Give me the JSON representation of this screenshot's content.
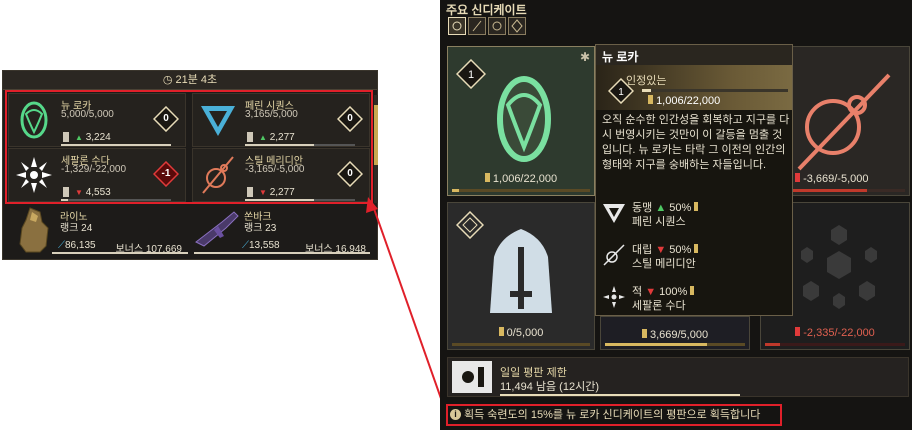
{
  "left_panel": {
    "timer": "21분 4초",
    "factions": [
      {
        "name": "뉴 로카",
        "score": "5,000/5,000",
        "points": "3,224",
        "trend": "up",
        "rank": "0",
        "bar": 1.0,
        "color": "#56d88a"
      },
      {
        "name": "페린 시퀀스",
        "score": "3,165/5,000",
        "points": "2,277",
        "trend": "up",
        "rank": "0",
        "bar": 0.63,
        "color": "#4ab0d8"
      },
      {
        "name": "세팔론 수다",
        "score": "-1,329/-22,000",
        "points": "4,553",
        "trend": "down",
        "rank": "-1",
        "bar": 0.06,
        "color": "#ffffff"
      },
      {
        "name": "스틸 메리디안",
        "score": "-3,165/-5,000",
        "points": "2,277",
        "trend": "down",
        "rank": "0",
        "bar": 0.63,
        "color": "#e07a5a"
      }
    ],
    "syndicate_reps": [
      {
        "name": "라이노",
        "rank": "랭크 24",
        "value": "86,135",
        "bonus": "보너스 107,669"
      },
      {
        "name": "쏜바크",
        "rank": "랭크 23",
        "value": "13,558",
        "bonus": "보너스 16,948"
      }
    ]
  },
  "right_panel": {
    "title": "주요 신디케이트",
    "tabs": [
      "syndicate-tab-1",
      "syndicate-tab-2",
      "syndicate-tab-3",
      "syndicate-tab-4"
    ],
    "cards": [
      {
        "id": "new-loka",
        "value": "1,006/22,000",
        "rank": "1",
        "bar": 0.05
      },
      {
        "id": "steel-meridian",
        "value": "-3,669/-5,000",
        "bar": 0.73
      },
      {
        "id": "hexis",
        "value": "0/5,000",
        "bar": 0.0
      },
      {
        "id": "perrin",
        "value": "3,669/5,000",
        "bar": 0.73
      },
      {
        "id": "cephalon",
        "value": "-2,335/-22,000",
        "bar": 0.11
      }
    ],
    "tooltip": {
      "name": "뉴 로카",
      "level": "인정있는",
      "rank": "1",
      "reputation": "1,006/22,000",
      "description": "오직 순수한 인간성을 회복하고 지구를 다시 번영시키는 것만이 이 갈등을 멈출 것입니다. 뉴 로카는 타락 그 이전의 인간의 형태와 지구를 숭배하는 자들입니다.",
      "relations": [
        {
          "type": "동맹",
          "arrow": "▲",
          "pct": "50%",
          "faction": "페린 시퀀스",
          "arrow_color": "#4fc864"
        },
        {
          "type": "대립",
          "arrow": "▼",
          "pct": "50%",
          "faction": "스틸 메리디안",
          "arrow_color": "#e03a3a"
        },
        {
          "type": "적",
          "arrow": "▼",
          "pct": "100%",
          "faction": "세팔론 수다",
          "arrow_color": "#e03a3a"
        }
      ]
    },
    "daily": {
      "title": "일일 평판 제한",
      "value": "11,494 남음 (12시간)"
    },
    "info": "획득 숙련도의 15%를 뉴 로카 신디케이트의 평판으로 획득합니다"
  },
  "colors": {
    "highlight": "#e0202a",
    "gold": "#d8b860",
    "accent_green": "#56d88a"
  }
}
